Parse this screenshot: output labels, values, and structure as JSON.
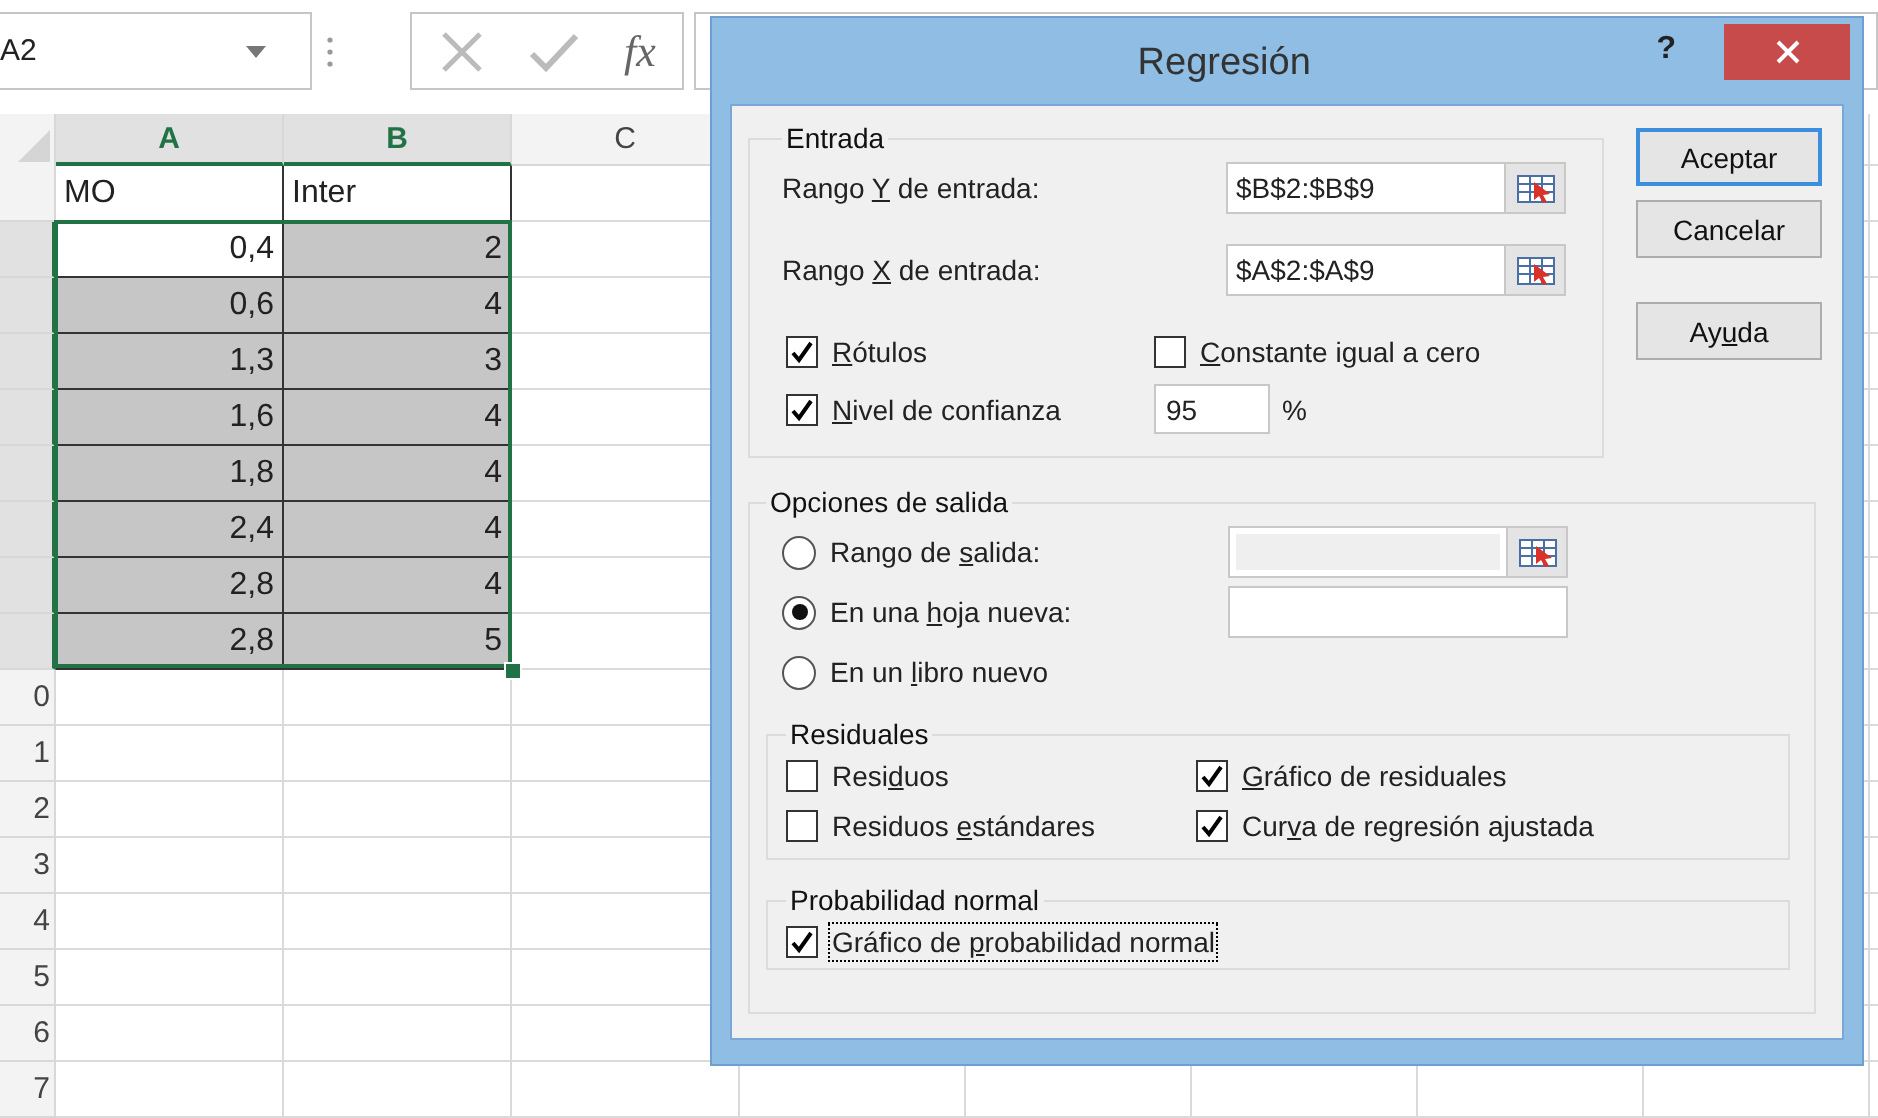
{
  "formula_bar": {
    "name_box": "A2",
    "function_label": "fx"
  },
  "sheet": {
    "columns": [
      {
        "label": "A",
        "selected": true
      },
      {
        "label": "B",
        "selected": true
      },
      {
        "label": "C",
        "selected": false
      }
    ],
    "rows": [
      {
        "selected": false,
        "kind": "labels",
        "cells": [
          {
            "text": "MO"
          },
          {
            "text": "Inter"
          }
        ]
      },
      {
        "selected": true,
        "kind": "values",
        "cells": [
          {
            "text": "0,4",
            "active": true
          },
          {
            "text": "2",
            "active": false
          }
        ]
      },
      {
        "selected": true,
        "kind": "values",
        "cells": [
          {
            "text": "0,6",
            "active": false
          },
          {
            "text": "4",
            "active": false
          }
        ]
      },
      {
        "selected": true,
        "kind": "values",
        "cells": [
          {
            "text": "1,3",
            "active": false
          },
          {
            "text": "3",
            "active": false
          }
        ]
      },
      {
        "selected": true,
        "kind": "values",
        "cells": [
          {
            "text": "1,6",
            "active": false
          },
          {
            "text": "4",
            "active": false
          }
        ]
      },
      {
        "selected": true,
        "kind": "values",
        "cells": [
          {
            "text": "1,8",
            "active": false
          },
          {
            "text": "4",
            "active": false
          }
        ]
      },
      {
        "selected": true,
        "kind": "values",
        "cells": [
          {
            "text": "2,4",
            "active": false
          },
          {
            "text": "4",
            "active": false
          }
        ]
      },
      {
        "selected": true,
        "kind": "values",
        "cells": [
          {
            "text": "2,8",
            "active": false
          },
          {
            "text": "4",
            "active": false
          }
        ]
      },
      {
        "selected": true,
        "kind": "values",
        "cells": [
          {
            "text": "2,8",
            "active": false
          },
          {
            "text": "5",
            "active": false
          }
        ]
      },
      {
        "selected": false,
        "header": "0"
      },
      {
        "selected": false,
        "header": "1"
      },
      {
        "selected": false,
        "header": "2"
      },
      {
        "selected": false,
        "header": "3"
      },
      {
        "selected": false,
        "header": "4"
      },
      {
        "selected": false,
        "header": "5"
      },
      {
        "selected": false,
        "header": "6"
      },
      {
        "selected": false,
        "header": "7"
      }
    ]
  },
  "dialog": {
    "title": "Regresión",
    "help": "?",
    "input": {
      "label": "Entrada",
      "ranges": [
        {
          "label": {
            "before": "Rango ",
            "key": "Y",
            "after": " de entrada:"
          },
          "value": "$B$2:$B$9"
        },
        {
          "label": {
            "before": "Rango ",
            "key": "X",
            "after": " de entrada:"
          },
          "value": "$A$2:$A$9"
        }
      ],
      "options": [
        {
          "label": {
            "key": "R",
            "after": "ótulos"
          },
          "checked": true
        },
        {
          "label": {
            "key": "C",
            "after": "onstante igual a cero"
          },
          "checked": false
        },
        {
          "label": {
            "key": "N",
            "after": "ivel de confianza"
          },
          "checked": true
        }
      ],
      "confidence": {
        "value": "95",
        "unit": "%"
      }
    },
    "buttons": [
      {
        "label": {
          "before": "Aceptar"
        },
        "default": true
      },
      {
        "label": {
          "before": "Cancelar"
        },
        "default": false
      },
      {
        "label": {
          "before": "Ay",
          "key": "u",
          "after": "da"
        },
        "default": false
      }
    ],
    "output": {
      "label": "Opciones de salida",
      "destinations": [
        {
          "label": {
            "before": "Rango de ",
            "key": "s",
            "after": "alida:"
          },
          "selected": false,
          "field": {
            "disabled": true,
            "picker": true
          }
        },
        {
          "label": {
            "before": "En una ",
            "key": "h",
            "after": "oja nueva:"
          },
          "selected": true,
          "field": {
            "disabled": false,
            "picker": false
          }
        },
        {
          "label": {
            "before": "En un ",
            "key": "l",
            "after": "ibro nuevo"
          },
          "selected": false
        }
      ],
      "residuals": {
        "label": "Residuales",
        "options": [
          {
            "label": {
              "before": "Resi",
              "key": "d",
              "after": "uos"
            },
            "checked": false
          },
          {
            "label": {
              "key": "G",
              "after": "ráfico de residuales"
            },
            "checked": true
          },
          {
            "label": {
              "before": "Residuos ",
              "key": "e",
              "after": "stándares"
            },
            "checked": false
          },
          {
            "label": {
              "before": "Cur",
              "key": "v",
              "after": "a de regresión ajustada"
            },
            "checked": true
          }
        ]
      },
      "normal_probability": {
        "label": "Probabilidad normal",
        "options": [
          {
            "label": {
              "before": "Gráfico de ",
              "key": "p",
              "after": "robabilidad normal"
            },
            "checked": true,
            "focused": true
          }
        ]
      }
    }
  }
}
